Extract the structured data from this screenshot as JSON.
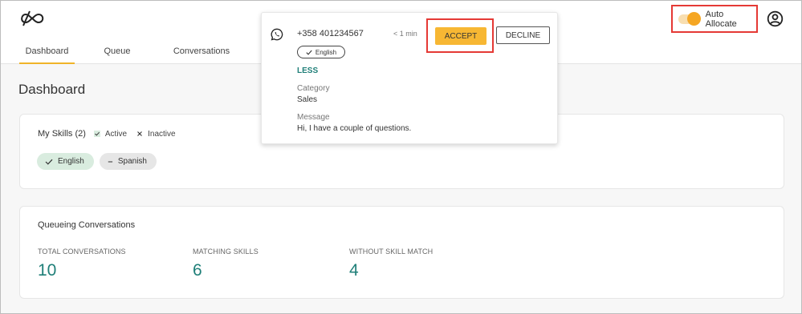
{
  "header": {
    "tabs": [
      {
        "label": "Dashboard"
      },
      {
        "label": "Queue"
      },
      {
        "label": "Conversations"
      }
    ],
    "auto_allocate": {
      "label": "Auto Allocate",
      "enabled": true
    },
    "accent_color": "#f0b429"
  },
  "popup": {
    "phone": "+358 401234567",
    "eta": "< 1 min",
    "language_chip": "English",
    "less_link": "LESS",
    "category_label": "Category",
    "category_value": "Sales",
    "message_label": "Message",
    "message_value": "Hi, I have a couple of questions.",
    "accept_label": "ACCEPT",
    "decline_label": "DECLINE",
    "channel_icon": "whatsapp-icon"
  },
  "main": {
    "title": "Dashboard",
    "skills": {
      "title": "My Skills (2)",
      "legend_active": "Active",
      "legend_inactive": "Inactive",
      "chips": [
        {
          "label": "English",
          "status": "active"
        },
        {
          "label": "Spanish",
          "status": "inactive"
        }
      ]
    },
    "queue": {
      "title": "Queueing Conversations",
      "stats": [
        {
          "label": "TOTAL CONVERSATIONS",
          "value": "10"
        },
        {
          "label": "MATCHING SKILLS",
          "value": "6"
        },
        {
          "label": "WITHOUT SKILL MATCH",
          "value": "4"
        }
      ]
    }
  },
  "colors": {
    "teal": "#1f7f78",
    "accept": "#f7b733",
    "highlight": "#e53935"
  }
}
